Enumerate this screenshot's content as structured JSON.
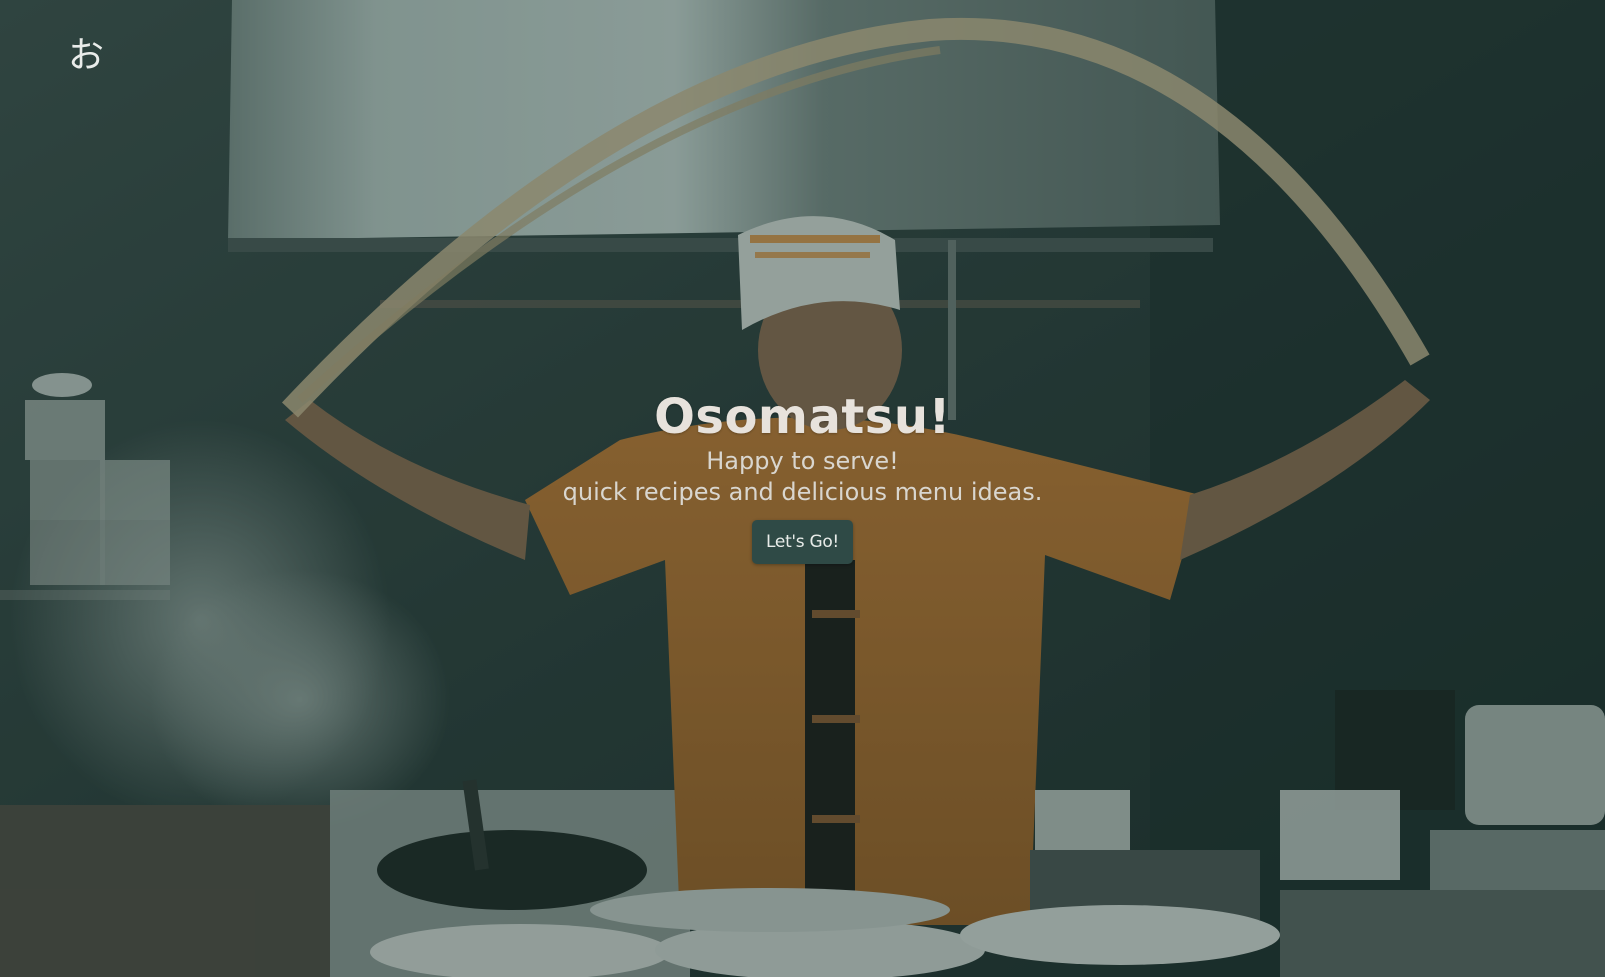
{
  "header": {
    "logo_text": "お"
  },
  "hero": {
    "title": "Osomatsu!",
    "subtitle_line1": "Happy to serve!",
    "subtitle_line2": "quick recipes and delicious menu ideas.",
    "cta_label": "Let's Go!"
  },
  "colors": {
    "overlay": "#18302c",
    "button_bg": "#2f4a46",
    "text_light": "#e7e2dc",
    "chef_shirt": "#b8732e"
  }
}
